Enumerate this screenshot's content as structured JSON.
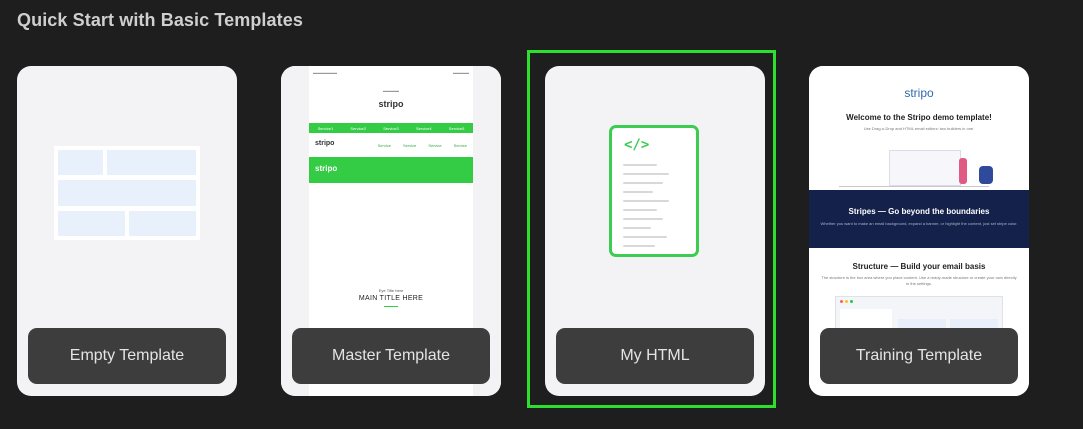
{
  "section": {
    "title": "Quick Start with Basic Templates"
  },
  "cards": [
    {
      "label": "Empty Template"
    },
    {
      "label": "Master Template"
    },
    {
      "label": "My HTML"
    },
    {
      "label": "Training Template"
    }
  ],
  "master_preview": {
    "logo": "stripo",
    "nav": [
      "Service1",
      "Service2",
      "Service3",
      "Service4",
      "Service5"
    ],
    "menu": [
      "Service",
      "Service",
      "Service",
      "Service"
    ],
    "title_small": "Eye Title here",
    "title": "MAIN TITLE HERE"
  },
  "html_card": {
    "code_mark": "</>"
  },
  "training_preview": {
    "logo": "stripo",
    "heading": "Welcome to the Stripo demo template!",
    "subheading": "Use Drag-n-Drop and HTML email editors: two builders in one.",
    "stripes_title": "Stripes — Go beyond the boundaries",
    "stripes_text": "Whether you want to make an email background, expand a banner, or highlight the content, just set stripe color.",
    "structure_title": "Structure — Build your email basis",
    "structure_text": "The structure is the box area where you place content. Use a ready-made structure or create your own directly in the settings."
  },
  "colors": {
    "accent_green": "#2ee02e",
    "stripo_green": "#33cc44",
    "navy": "#13214b"
  }
}
